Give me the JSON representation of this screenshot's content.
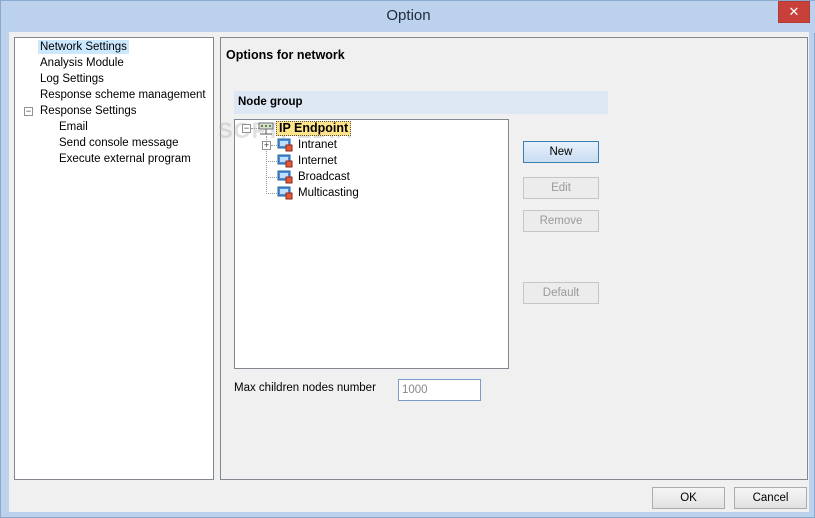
{
  "window": {
    "title": "Option",
    "close_glyph": "✕"
  },
  "nav": {
    "items": [
      {
        "label": "Network Settings",
        "selected": true
      },
      {
        "label": "Analysis Module"
      },
      {
        "label": "Log Settings"
      },
      {
        "label": "Response scheme management"
      },
      {
        "label": "Response Settings",
        "expander": "−"
      },
      {
        "label": "Email"
      },
      {
        "label": "Send console message"
      },
      {
        "label": "Execute external program"
      }
    ]
  },
  "main": {
    "title": "Options for network",
    "node_group": {
      "header": "Node group",
      "root": {
        "label": "IP Endpoint",
        "expander": "−"
      },
      "children": [
        {
          "label": "Intranet",
          "expander": "+"
        },
        {
          "label": "Internet"
        },
        {
          "label": "Broadcast"
        },
        {
          "label": "Multicasting"
        }
      ]
    },
    "buttons": {
      "new": "New",
      "edit": "Edit",
      "remove": "Remove",
      "default": "Default"
    },
    "max_children": {
      "label": "Max children nodes number",
      "value": "1000"
    },
    "watermark": "SOFTPEDIA"
  },
  "footer": {
    "ok": "OK",
    "cancel": "Cancel"
  },
  "icons": {
    "node_icon": "network-node-icon",
    "root_icon": "network-root-icon"
  },
  "colors": {
    "selection": "#cce8ff",
    "root_highlight": "#ffe48a",
    "close": "#c7403a",
    "titlebar": "#bcd2ec"
  }
}
